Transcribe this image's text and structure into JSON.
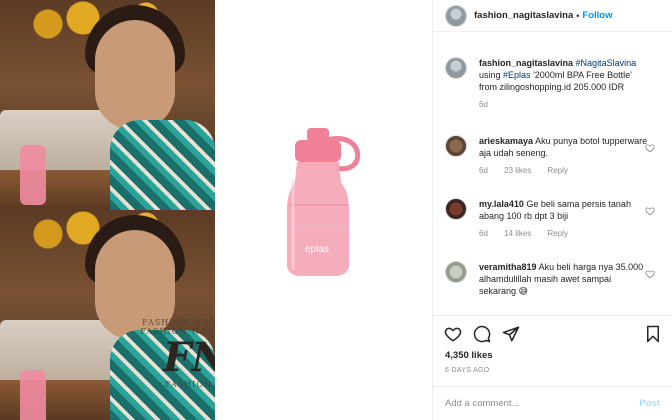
{
  "header": {
    "username": "fashion_nagitaslavina",
    "separator": "•",
    "follow_label": "Follow"
  },
  "caption": {
    "username": "fashion_nagitaslavina",
    "hashtag": "#NagitaSlavina",
    "text_before_tag": "using",
    "tag": "#Eplas",
    "text_after_tag": "'2000ml BPA Free Bottle' from zilingoshopping.id 205.000 IDR",
    "age": "6d"
  },
  "comments": [
    {
      "username": "arieskamaya",
      "text": "Aku punya botol tupperware aja udah seneng.",
      "age": "6d",
      "likes": "23 likes",
      "reply": "Reply"
    },
    {
      "username": "my.lala410",
      "text": "Ge beli sama persis tanah abang 100 rb dpt 3 biji",
      "age": "6d",
      "likes": "14 likes",
      "reply": "Reply"
    },
    {
      "username": "veramitha819",
      "text": "Aku beli harga nya 35.000 alhamdulillah masih awet sampai sekarang 😅",
      "age": "",
      "likes": "",
      "reply": ""
    }
  ],
  "actions": {
    "likes": "4,350 likes",
    "date": "6 DAYS AGO"
  },
  "add_comment": {
    "placeholder": "Add a comment...",
    "post_label": "Post"
  },
  "watermark": {
    "line1": "FASHION_NAGITASLAVINA",
    "line2": "FASHION_NAGITA SLAVINA",
    "logo": "FNS",
    "line3": "FASHION_FAMILY"
  },
  "product": {
    "brand_text": "eplas",
    "bottle_color": "#f4a3b4",
    "cap_color": "#f07f98"
  },
  "colors": {
    "accent": "#0095f6",
    "muted": "#8e8e8e",
    "post_disabled": "#b3dbff"
  }
}
